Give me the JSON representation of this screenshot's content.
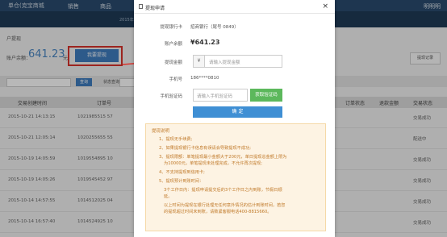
{
  "nav": {
    "brand": "单仓(克宝商城",
    "items": [
      "销售",
      "商品"
    ],
    "right": "明明明",
    "date": "2015年1月"
  },
  "page": {
    "breadcrumb": "户提现",
    "account_label": "账户余额：",
    "balance": "641.23",
    "yuan": "元",
    "withdraw_button": "我要提现",
    "record_button": "提现记录",
    "search_button": "查询",
    "status_label": "状态查询",
    "columns": [
      "交易创建时间",
      "订单号",
      "订单状态",
      "退款金额",
      "交易状态"
    ],
    "rows": [
      {
        "time": "2015-10-21 14:13:15",
        "order": "1021985515 57",
        "status": "交易成功"
      },
      {
        "time": "2015-10-21 12:05:14",
        "order": "1020255655 55",
        "status": "配送中"
      },
      {
        "time": "2015-10-19 14:05:59",
        "order": "1019554895 10",
        "status": "交易成功"
      },
      {
        "time": "2015-10-19 14:05:26",
        "order": "1019545452 97",
        "status": "交易成功"
      },
      {
        "time": "2015-10-14 14:57:55",
        "order": "1014512025 04",
        "status": "交易成功"
      },
      {
        "time": "2015-10-14 16:57:40",
        "order": "1014524925 10",
        "status": "交易成功"
      }
    ]
  },
  "modal": {
    "title": "提现申请",
    "bank_label": "提现银行卡",
    "bank_value": "招商银行（尾号 0849）",
    "balance_label": "账户余额",
    "balance_value": "¥641.23",
    "amount_label": "提现金额",
    "amount_prefix": "¥",
    "amount_placeholder": "请输入提现金额",
    "phone_label": "手机号",
    "phone_value": "186****0810",
    "code_label": "手机验证码",
    "code_placeholder": "请输入手机验证码",
    "code_button": "获取验证码",
    "submit_button": "确 定",
    "notes_title": "提现说明",
    "notes": [
      "1、提现无手续费;",
      "2、如果提现银行卡信息有误请会导致提现不成功;",
      "3、提现限额：单笔提现最小金额大于200元，单日提现总金额上限为",
      "为10000元，单笔提现未处理完成，不允许再次提现;",
      "4、不支持提现到信用卡;",
      "5、提现预计到账时间：",
      "3个工作日内：提现申请提交后的3个工作日之内到账，节假日顺",
      "延。",
      "以上时间为提现在银行处理无任何意外情况的估计到账时间，若您",
      "的提现超过时间未到账，请致紧客服电话400-8815660。"
    ]
  },
  "colors": {
    "accent": "#3f7dc0",
    "highlight": "#d9322b",
    "green": "#5cb85c",
    "notes_text": "#c07a2a"
  }
}
